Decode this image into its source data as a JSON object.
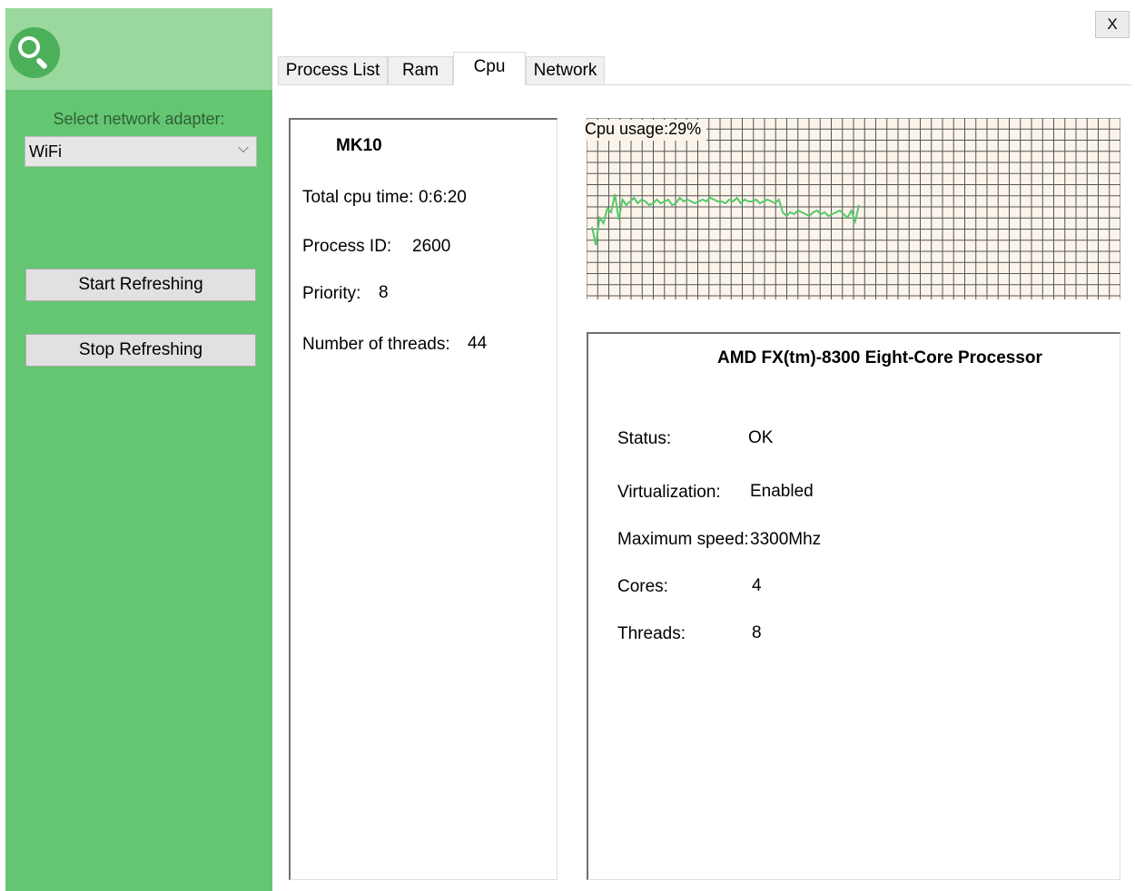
{
  "window": {
    "close_label": "X"
  },
  "sidebar": {
    "adapter_label": "Select network adapter:",
    "adapter_value": "WiFi",
    "adapter_chevron": "⌵",
    "start_label": "Start Refreshing",
    "stop_label": "Stop Refreshing",
    "logo_icon": "search-icon",
    "colors": {
      "background": "#64c672",
      "header": "#9ad89e"
    }
  },
  "tabs": [
    {
      "label": "Process List",
      "active": false
    },
    {
      "label": "Ram",
      "active": false
    },
    {
      "label": "Cpu",
      "active": true
    },
    {
      "label": "Network",
      "active": false
    }
  ],
  "process": {
    "name": "MK10",
    "total_cpu_time_label": "Total cpu time:",
    "total_cpu_time_value": "0:6:20",
    "process_id_label": "Process ID:",
    "process_id_value": "2600",
    "priority_label": "Priority:",
    "priority_value": "8",
    "threads_label": "Number of threads:",
    "threads_value": "44"
  },
  "cpu_graph": {
    "usage_label": "Cpu usage:29%",
    "usage_percent": 29,
    "line_color": "#55c96a",
    "grid_color": "#555555",
    "background": "#fbf4ea",
    "samples": [
      40,
      30,
      45,
      42,
      50,
      48,
      58,
      44,
      55,
      52,
      54,
      56,
      53,
      55,
      54,
      52,
      53,
      55,
      53,
      54,
      55,
      52,
      53,
      56,
      54,
      55,
      54,
      53,
      54,
      55,
      54,
      56,
      55,
      54,
      54,
      53,
      55,
      54,
      56,
      53,
      55,
      54,
      54,
      55,
      53,
      54,
      55,
      54,
      53,
      55,
      48,
      46,
      48,
      47,
      49,
      48,
      47,
      46,
      48,
      49,
      47,
      48,
      46,
      47,
      48,
      49,
      47,
      45,
      49,
      43,
      52
    ]
  },
  "cpu_info": {
    "name": "AMD FX(tm)-8300 Eight-Core Processor",
    "status_label": "Status:",
    "status_value": "OK",
    "virtualization_label": "Virtualization:",
    "virtualization_value": "Enabled",
    "max_speed_label": "Maximum speed:",
    "max_speed_value": "3300Mhz",
    "cores_label": "Cores:",
    "cores_value": "4",
    "threads_label": "Threads:",
    "threads_value": "8"
  }
}
